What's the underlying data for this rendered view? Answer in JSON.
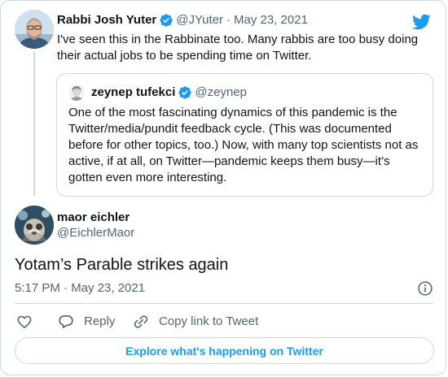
{
  "parent_tweet": {
    "author_name": "Rabbi Josh Yuter",
    "author_handle": "@JYuter",
    "separator": "·",
    "date": "May 23, 2021",
    "text": "I've seen this in the Rabbinate too. Many rabbis are too busy doing their actual jobs to be spending time on Twitter.",
    "verified": true
  },
  "quoted_tweet": {
    "author_name": "zeynep tufekci",
    "author_handle": "@zeynep",
    "verified": true,
    "text": "One of the most fascinating dynamics of this pandemic is the Twitter/media/pundit feedback cycle. (This was documented before for other topics, too.) Now, with many top scientists not as active, if at all, on Twitter—pandemic keeps them busy—it’s gotten even more interesting."
  },
  "main_tweet": {
    "author_name": "maor eichler",
    "author_handle": "@EichlerMaor",
    "text": "Yotam’s Parable strikes again",
    "timestamp": "5:17 PM · May 23, 2021"
  },
  "actions": {
    "like_icon": "heart-icon",
    "reply_label": "Reply",
    "reply_icon": "reply-icon",
    "copy_label": "Copy link to Tweet",
    "copy_icon": "link-icon"
  },
  "explore_button": {
    "label": "Explore what's happening on Twitter"
  },
  "icons": {
    "brand": "twitter-bird-icon",
    "info": "info-icon",
    "verified": "verified-badge-icon"
  },
  "colors": {
    "twitter_blue": "#1d9bf0",
    "text_primary": "#0f1419",
    "text_secondary": "#536471",
    "border": "#cfd9de"
  }
}
